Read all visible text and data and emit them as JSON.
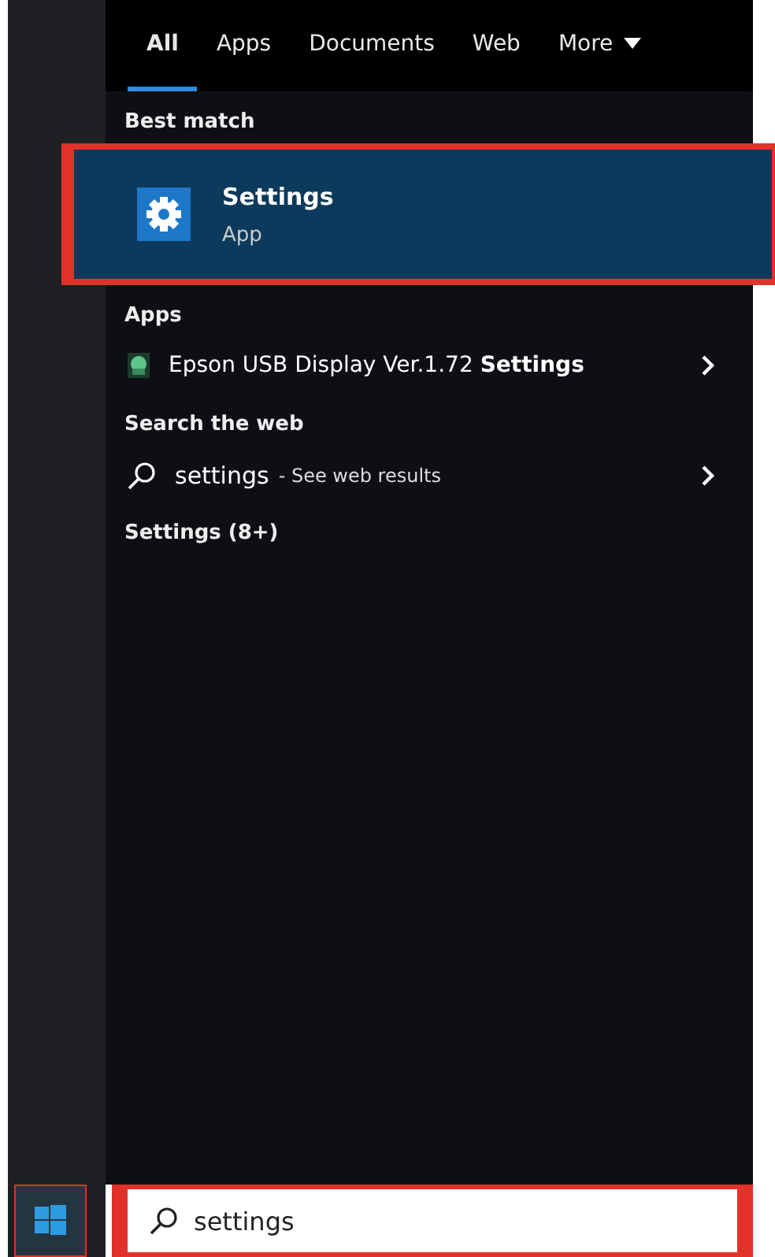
{
  "tabs": [
    {
      "label": "All",
      "selected": true
    },
    {
      "label": "Apps",
      "selected": false
    },
    {
      "label": "Documents",
      "selected": false
    },
    {
      "label": "Web",
      "selected": false
    },
    {
      "label": "More",
      "selected": false,
      "dropdown": true
    }
  ],
  "best_match": {
    "heading": "Best match",
    "title": "Settings",
    "subtitle": "App",
    "annotated": true
  },
  "apps": {
    "heading": "Apps",
    "items": [
      {
        "label": "Epson USB Display Ver.1.72 **Settings**"
      }
    ]
  },
  "web": {
    "heading": "Search the web",
    "query": "settings",
    "hint": "- See web results"
  },
  "settings_group": {
    "heading": "Settings (8+)"
  },
  "taskbar": {
    "start_annotated": true,
    "search": {
      "value": "settings",
      "annotated": true
    }
  }
}
